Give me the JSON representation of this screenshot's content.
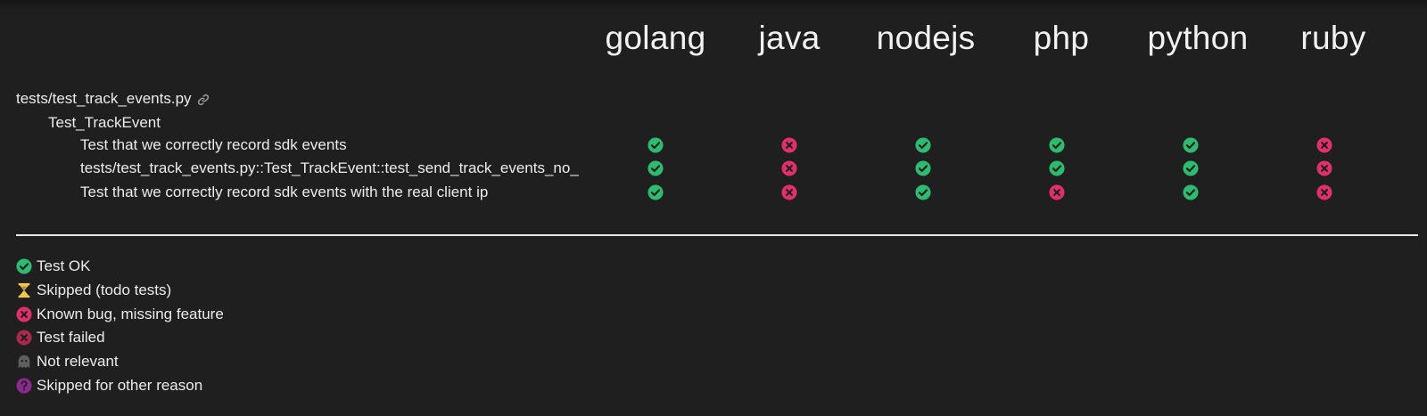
{
  "columns": [
    "golang",
    "java",
    "nodejs",
    "php",
    "python",
    "ruby"
  ],
  "file": {
    "name": "tests/test_track_events.py",
    "link_icon": "link-icon"
  },
  "class_name": "Test_TrackEvent",
  "rows": [
    {
      "label": "Test that we correctly record sdk events",
      "statuses": [
        "ok",
        "bug",
        "ok",
        "ok",
        "ok",
        "bug"
      ]
    },
    {
      "label": "tests/test_track_events.py::Test_TrackEvent::test_send_track_events_no_",
      "statuses": [
        "ok",
        "bug",
        "ok",
        "ok",
        "ok",
        "bug"
      ]
    },
    {
      "label": "Test that we correctly record sdk events with the real client ip",
      "statuses": [
        "ok",
        "bug",
        "ok",
        "bug",
        "ok",
        "bug"
      ]
    }
  ],
  "legend": [
    {
      "icon": "check-circle-icon",
      "kind": "ok",
      "label": "Test OK"
    },
    {
      "icon": "hourglass-icon",
      "kind": "skipped",
      "label": "Skipped (todo tests)"
    },
    {
      "icon": "x-circle-icon",
      "kind": "bug",
      "label": "Known bug, missing feature"
    },
    {
      "icon": "x-circle-dark-icon",
      "kind": "failed",
      "label": "Test failed"
    },
    {
      "icon": "ghost-icon",
      "kind": "irrelevant",
      "label": "Not relevant"
    },
    {
      "icon": "question-circle-icon",
      "kind": "other",
      "label": "Skipped for other reason"
    }
  ],
  "colors": {
    "ok": "#2ebb6f",
    "bug": "#e0306a",
    "failed": "#a9294f",
    "skipped": "#f2c94c",
    "irrelevant": "#5f5f5f",
    "other": "#8a2a8c",
    "background": "#1f1f1f",
    "text": "#ececec"
  }
}
